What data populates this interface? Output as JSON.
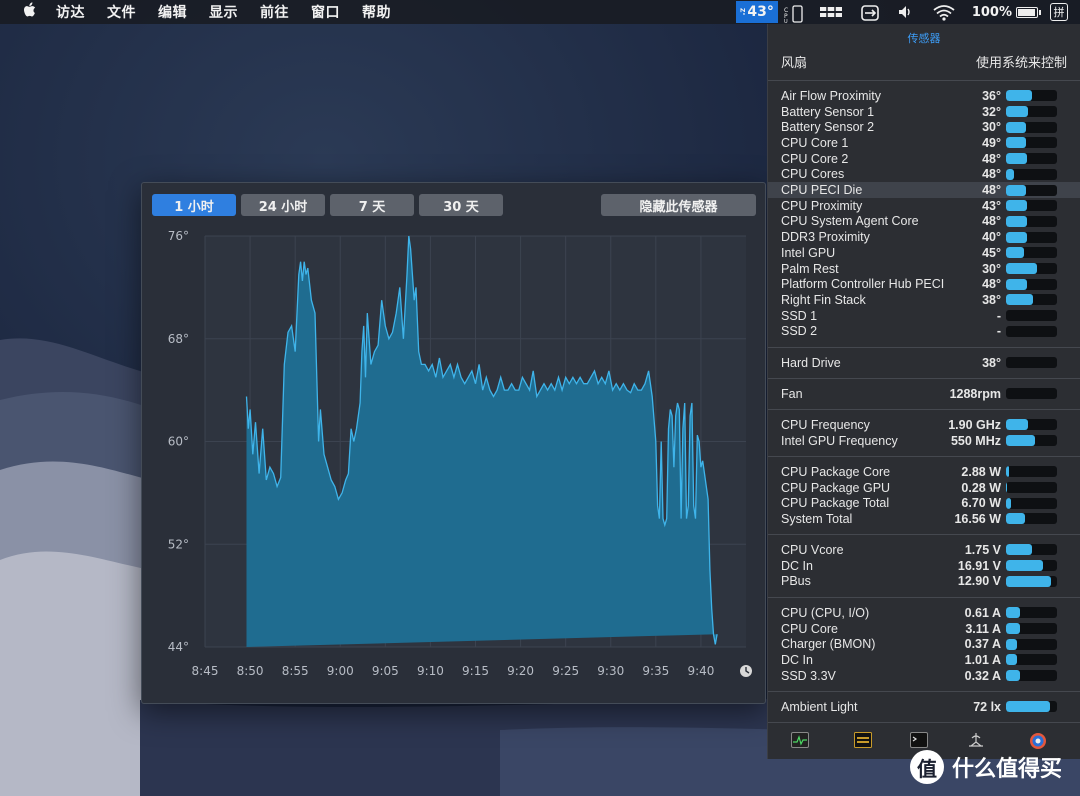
{
  "menubar": {
    "apple_icon": "apple-icon",
    "items": [
      "访达",
      "文件",
      "编辑",
      "显示",
      "前往",
      "窗口",
      "帮助"
    ],
    "temp_value": "43°",
    "battery_text": "100%",
    "battery_level": 1.0,
    "ime_label": "拼"
  },
  "graph": {
    "tabs": [
      {
        "label": "1 小时",
        "active": true
      },
      {
        "label": "24 小时",
        "active": false
      },
      {
        "label": "7 天",
        "active": false
      },
      {
        "label": "30 天",
        "active": false
      }
    ],
    "hide_button": "隐藏此传感器",
    "fill_color": "#1f6c90",
    "line_color": "#3fb4ea"
  },
  "chart_data": {
    "type": "area",
    "title": "",
    "xlabel": "",
    "ylabel": "",
    "ylim": [
      44,
      76
    ],
    "y_ticks": [
      "76°",
      "68°",
      "60°",
      "52°",
      "44°"
    ],
    "y_tick_values": [
      76,
      68,
      60,
      52,
      44
    ],
    "x_ticks": [
      "8:45",
      "8:50",
      "8:55",
      "9:00",
      "9:05",
      "9:10",
      "9:15",
      "9:20",
      "9:25",
      "9:30",
      "9:35",
      "9:40"
    ],
    "x_tick_minutes": [
      0,
      5,
      10,
      15,
      20,
      25,
      30,
      35,
      40,
      45,
      50,
      55
    ],
    "xlim_minutes": [
      0,
      60
    ],
    "grid": true,
    "series": [
      {
        "x_minutes": [
          4.6,
          4.8,
          5.0,
          5.3,
          5.6,
          6.0,
          6.4,
          6.8,
          7.2,
          7.6,
          8.0,
          8.4,
          8.8,
          9.2,
          9.6,
          10.0,
          10.4,
          10.6,
          10.8,
          11.0,
          11.2,
          11.4,
          11.8,
          12.2,
          12.6,
          12.8,
          13.2,
          13.6,
          14.0,
          14.4,
          14.8,
          15.2,
          15.6,
          15.9,
          16.2,
          16.5,
          16.8,
          17.0,
          17.2,
          17.4,
          17.6,
          17.8,
          18.0,
          18.4,
          18.8,
          19.2,
          19.6,
          20.0,
          20.4,
          20.8,
          21.2,
          21.6,
          22.0,
          22.4,
          22.6,
          22.8,
          23.0,
          23.2,
          23.4,
          23.7,
          24.0,
          24.4,
          24.8,
          25.2,
          25.6,
          26.0,
          26.4,
          26.8,
          27.2,
          27.6,
          28.0,
          28.4,
          28.8,
          29.2,
          29.6,
          30.0,
          30.4,
          30.8,
          31.2,
          31.6,
          32.0,
          32.4,
          32.8,
          33.2,
          33.6,
          34.0,
          34.4,
          34.8,
          35.2,
          35.6,
          36.0,
          36.4,
          36.8,
          37.2,
          37.6,
          38.0,
          38.4,
          38.8,
          39.2,
          39.6,
          40.0,
          40.4,
          40.8,
          41.2,
          41.6,
          42.0,
          42.4,
          42.8,
          43.2,
          43.6,
          44.0,
          44.4,
          44.8,
          45.2,
          45.6,
          46.0,
          46.4,
          46.8,
          47.2,
          47.6,
          48.0,
          48.4,
          48.8,
          49.2,
          49.6,
          50.0,
          50.2,
          50.4,
          50.6,
          50.8,
          51.0,
          51.2,
          51.4,
          51.6,
          51.8,
          52.0,
          52.2,
          52.4,
          52.6,
          52.8,
          53.0,
          53.2,
          53.4,
          53.6,
          53.8,
          54.0,
          54.2,
          54.4,
          54.6,
          54.8,
          55.0,
          55.2,
          55.4,
          55.6,
          55.8,
          56.0,
          56.2,
          56.4,
          56.6,
          56.8,
          57.0,
          57.2,
          57.4,
          57.6,
          57.8,
          58.0,
          58.2,
          58.4,
          58.6,
          58.8,
          59.0,
          59.2,
          59.4,
          59.6
        ],
        "values": [
          63.5,
          61,
          62.5,
          59,
          61.5,
          57.5,
          61,
          57,
          58,
          57.5,
          56.5,
          57.2,
          66,
          68.5,
          69,
          67,
          73,
          74,
          72.5,
          74,
          73,
          73.5,
          71,
          70,
          60,
          62.5,
          59,
          58,
          57,
          56.5,
          55.5,
          56,
          57,
          57.5,
          61,
          60,
          61,
          62,
          63,
          67,
          69,
          65,
          70,
          66,
          67,
          67.5,
          71,
          69,
          68,
          68.5,
          70,
          72,
          68,
          73,
          76,
          75,
          73,
          71,
          72,
          67,
          66,
          66,
          65.5,
          66,
          65,
          66.5,
          65,
          65.5,
          66,
          65,
          66,
          65,
          64.5,
          65,
          65.5,
          64.5,
          66,
          64,
          65,
          64,
          63.5,
          64,
          65,
          64,
          64,
          64.5,
          64,
          64,
          65,
          64.5,
          64,
          65.5,
          63.5,
          64,
          64.5,
          64,
          64.5,
          64,
          65,
          64,
          65,
          64.5,
          65,
          64.5,
          65,
          64.5,
          64.5,
          65,
          65.5,
          64.5,
          65,
          64.5,
          65.5,
          64,
          64.5,
          64,
          64.5,
          64,
          63.8,
          64.5,
          64,
          64,
          64.5,
          65.5,
          63.5,
          60,
          55,
          54,
          60,
          54,
          53.5,
          54,
          61,
          62.5,
          62,
          58,
          62,
          63,
          62.5,
          54,
          61,
          63,
          54,
          55,
          62,
          63,
          55,
          54,
          60.5,
          60,
          58,
          58.5,
          57.5,
          56.5,
          55.5,
          50,
          47,
          45,
          44.2,
          45
        ]
      }
    ]
  },
  "panel": {
    "title": "传感器",
    "fan_label": "风扇",
    "fan_mode": "使用系统来控制",
    "temperatures": [
      {
        "label": "Air Flow Proximity",
        "value": "36°",
        "level": 0.5
      },
      {
        "label": "Battery Sensor 1",
        "value": "32°",
        "level": 0.44
      },
      {
        "label": "Battery Sensor 2",
        "value": "30°",
        "level": 0.4
      },
      {
        "label": "CPU Core 1",
        "value": "49°",
        "level": 0.4
      },
      {
        "label": "CPU Core 2",
        "value": "48°",
        "level": 0.42
      },
      {
        "label": "CPU Cores",
        "value": "48°",
        "level": 0.16
      },
      {
        "label": "CPU PECI Die",
        "value": "48°",
        "level": 0.4
      },
      {
        "label": "CPU Proximity",
        "value": "43°",
        "level": 0.42
      },
      {
        "label": "CPU System Agent Core",
        "value": "48°",
        "level": 0.42
      },
      {
        "label": "DDR3 Proximity",
        "value": "40°",
        "level": 0.42
      },
      {
        "label": "Intel GPU",
        "value": "45°",
        "level": 0.36
      },
      {
        "label": "Palm Rest",
        "value": "30°",
        "level": 0.6
      },
      {
        "label": "Platform Controller Hub PECI",
        "value": "48°",
        "level": 0.42
      },
      {
        "label": "Right Fin Stack",
        "value": "38°",
        "level": 0.52
      },
      {
        "label": "SSD 1",
        "value": "-",
        "level": 0
      },
      {
        "label": "SSD 2",
        "value": "-",
        "level": 0
      }
    ],
    "hard_drive": {
      "label": "Hard Drive",
      "value": "38°",
      "level": 0
    },
    "fan": {
      "label": "Fan",
      "value": "1288rpm",
      "level": 0
    },
    "frequencies": [
      {
        "label": "CPU Frequency",
        "value": "1.90 GHz",
        "level": 0.44
      },
      {
        "label": "Intel GPU Frequency",
        "value": "550 MHz",
        "level": 0.56
      }
    ],
    "power": [
      {
        "label": "CPU Package Core",
        "value": "2.88 W",
        "level": 0.06
      },
      {
        "label": "CPU Package GPU",
        "value": "0.28 W",
        "level": 0.02
      },
      {
        "label": "CPU Package Total",
        "value": "6.70 W",
        "level": 0.1
      },
      {
        "label": "System Total",
        "value": "16.56 W",
        "level": 0.38
      }
    ],
    "voltages": [
      {
        "label": "CPU Vcore",
        "value": "1.75 V",
        "level": 0.5
      },
      {
        "label": "DC In",
        "value": "16.91 V",
        "level": 0.72
      },
      {
        "label": "PBus",
        "value": "12.90 V",
        "level": 0.88
      }
    ],
    "currents": [
      {
        "label": "CPU (CPU, I/O)",
        "value": "0.61 A",
        "level": 0.28
      },
      {
        "label": "CPU Core",
        "value": "3.11 A",
        "level": 0.28
      },
      {
        "label": "Charger (BMON)",
        "value": "0.37 A",
        "level": 0.22
      },
      {
        "label": "DC In",
        "value": "1.01 A",
        "level": 0.22
      },
      {
        "label": "SSD 3.3V",
        "value": "0.32 A",
        "level": 0.28
      }
    ],
    "ambient": {
      "label": "Ambient Light",
      "value": "72 lx",
      "level": 0.86
    },
    "footer_icons": [
      "activity-monitor-icon",
      "app-icon",
      "terminal-icon",
      "network-icon",
      "preferences-icon"
    ]
  },
  "watermark": {
    "symbol": "值",
    "text": "什么值得买"
  }
}
